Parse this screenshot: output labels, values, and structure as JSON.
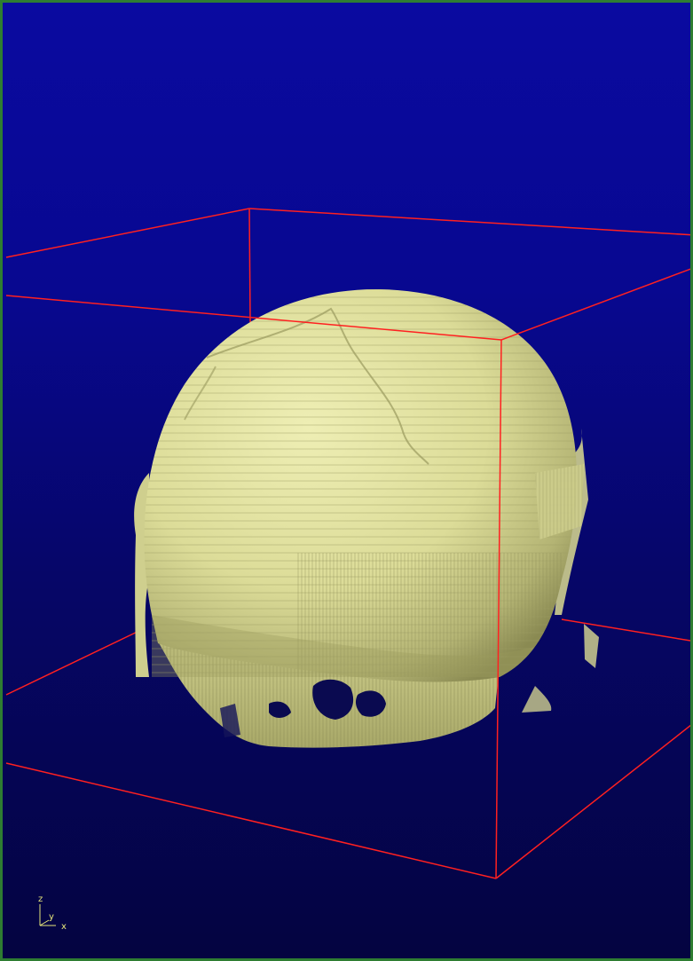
{
  "viewer": {
    "colors": {
      "frame_border": "#2e7d32",
      "background_top": "#0a0aa0",
      "background_bottom": "#040440",
      "bounding_box": "#ff2020",
      "surface": "#dcdc98"
    },
    "scene": {
      "object": "skull-isosurface",
      "bounding_box": true
    },
    "axes": {
      "z_label": "z",
      "y_label": "y",
      "x_label": "x"
    }
  }
}
